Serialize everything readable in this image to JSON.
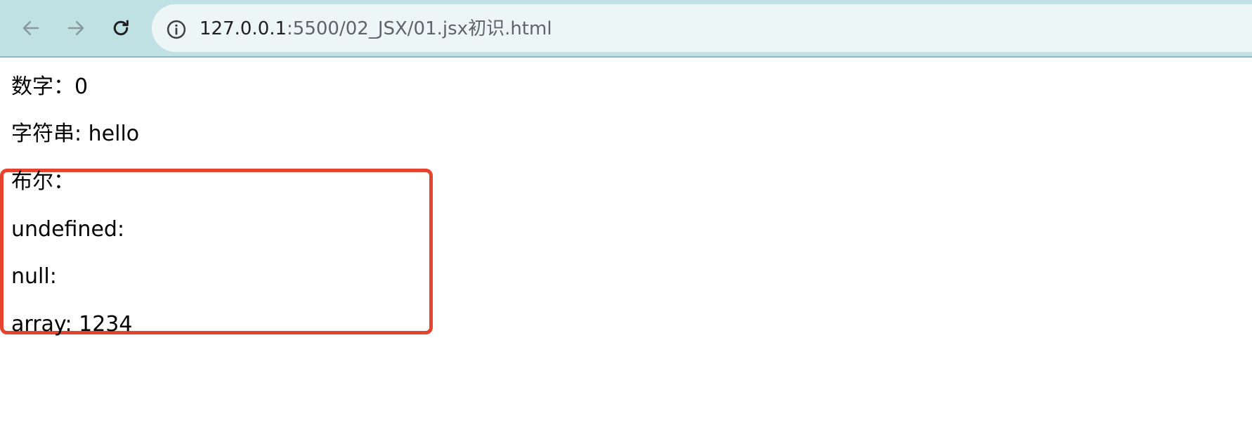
{
  "browser": {
    "url_host": "127.0.0.1",
    "url_path": ":5500/02_JSX/01.jsx初识.html",
    "back_icon": "arrow-left-icon",
    "forward_icon": "arrow-right-icon",
    "reload_icon": "reload-icon",
    "info_icon": "info-icon"
  },
  "page": {
    "lines": [
      "数字：0",
      "字符串: hello",
      "布尔：",
      "undefined:",
      "null:",
      "array: 1234"
    ]
  },
  "colors": {
    "toolbar": "#c0e1e4",
    "omnibox": "#edf6f7",
    "highlight": "#e5432d"
  }
}
